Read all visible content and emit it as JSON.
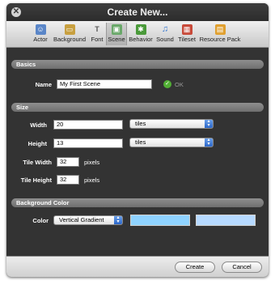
{
  "window": {
    "title": "Create New..."
  },
  "toolbar": {
    "items": [
      {
        "label": "Actor",
        "icon": "actor-icon",
        "active": false,
        "color": "#5a86c8"
      },
      {
        "label": "Background",
        "icon": "background-icon",
        "active": false,
        "color": "#c8a040"
      },
      {
        "label": "Font",
        "icon": "font-icon",
        "active": false,
        "color": "#7a7a7a"
      },
      {
        "label": "Scene",
        "icon": "scene-icon",
        "active": true,
        "color": "#6aa86a"
      },
      {
        "label": "Behavior",
        "icon": "behavior-icon",
        "active": false,
        "color": "#4a9a3a"
      },
      {
        "label": "Sound",
        "icon": "sound-icon",
        "active": false,
        "color": "#4a8ad8"
      },
      {
        "label": "Tileset",
        "icon": "tileset-icon",
        "active": false,
        "color": "#c84a3a"
      },
      {
        "label": "Resource Pack",
        "icon": "resource-pack-icon",
        "active": false,
        "color": "#e0a030"
      }
    ]
  },
  "basics": {
    "header": "Basics",
    "name_label": "Name",
    "name_value": "My First Scene",
    "ok_text": "OK"
  },
  "size": {
    "header": "Size",
    "width_label": "Width",
    "width_value": "20",
    "width_unit": "tiles",
    "height_label": "Height",
    "height_value": "13",
    "height_unit": "tiles",
    "tile_width_label": "Tile Width",
    "tile_width_value": "32",
    "tile_width_unit": "pixels",
    "tile_height_label": "Tile Height",
    "tile_height_value": "32",
    "tile_height_unit": "pixels"
  },
  "background": {
    "header": "Background Color",
    "color_label": "Color",
    "mode": "Vertical Gradient",
    "color1": "#8fd3ff",
    "color2": "#b7daff"
  },
  "footer": {
    "create_label": "Create",
    "cancel_label": "Cancel"
  }
}
